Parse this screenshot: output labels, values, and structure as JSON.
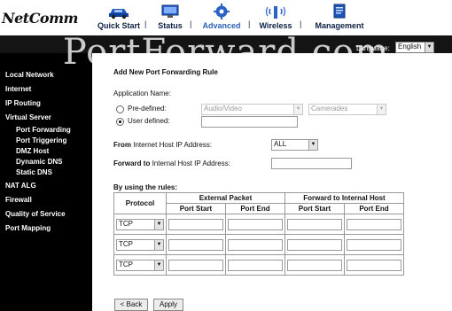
{
  "header": {
    "logo": "NetComm",
    "nav": [
      {
        "label": "Quick Start",
        "icon": "car-icon"
      },
      {
        "label": "Status",
        "icon": "monitor-icon"
      },
      {
        "label": "Advanced",
        "icon": "cogwheel-icon"
      },
      {
        "label": "Wireless",
        "icon": "wireless-icon"
      },
      {
        "label": "Management",
        "icon": "document-icon"
      }
    ],
    "separator": "|",
    "active_tab": "Advanced",
    "language_label": "Language:",
    "language_value": "English",
    "watermark": "PortForward.com"
  },
  "sidebar": {
    "items": [
      "Local Network",
      "Internet",
      "IP Routing",
      "Virtual Server",
      "Port Forwarding",
      "Port Triggering",
      "DMZ Host",
      "Dynamic DNS",
      "Static DNS",
      "NAT ALG",
      "Firewall",
      "Quality of Service",
      "Port Mapping"
    ]
  },
  "form": {
    "title": "Add New Port Forwarding Rule",
    "app_name_label": "Application Name:",
    "predefined_label": "Pre-defined:",
    "predefined_category": "Audio/Video",
    "predefined_app": "Camerades",
    "user_defined_label": "User defined:",
    "user_defined_value": "",
    "from_bold": "From",
    "from_rest": " Internet Host IP Address:",
    "from_value": "ALL",
    "forward_bold": "Forward to",
    "forward_rest": " Internal Host IP Address:",
    "forward_value": "",
    "rules_label": "By using the rules:",
    "table": {
      "protocol_header": "Protocol",
      "external_header": "External Packet",
      "internal_header": "Forward to Internal Host",
      "port_start": "Port Start",
      "port_end": "Port End",
      "rows": [
        {
          "protocol": "TCP",
          "ext_start": "",
          "ext_end": "",
          "int_start": "",
          "int_end": ""
        },
        {
          "protocol": "TCP",
          "ext_start": "",
          "ext_end": "",
          "int_start": "",
          "int_end": ""
        },
        {
          "protocol": "TCP",
          "ext_start": "",
          "ext_end": "",
          "int_start": "",
          "int_end": ""
        }
      ]
    },
    "back_button": "< Back",
    "apply_button": "Apply"
  },
  "colors": {
    "band": "#141414",
    "sidebar": "#000000",
    "nav_text": "#0b1f45",
    "nav_active": "#2d62b5"
  }
}
